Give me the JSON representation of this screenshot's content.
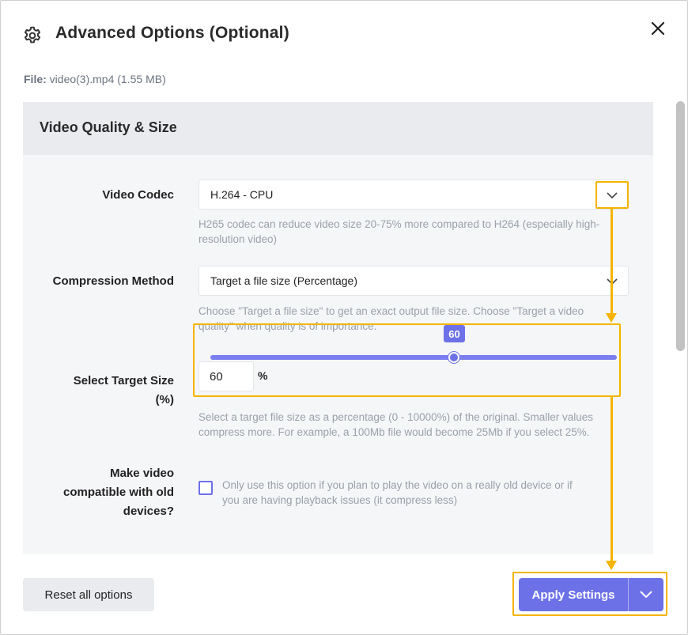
{
  "dialog": {
    "title": "Advanced Options (Optional)",
    "icon": "gear-icon",
    "close_icon": "close-icon"
  },
  "file": {
    "label": "File:",
    "value": "video(3).mp4 (1.55 MB)"
  },
  "section": {
    "title": "Video Quality & Size"
  },
  "video_codec": {
    "label": "Video Codec",
    "value": "H.264 - CPU",
    "help_line1": "H265 codec can reduce video size 20-75% more compared to H264 (especially high-",
    "help_line2": "resolution video)"
  },
  "compression_method": {
    "label": "Compression Method",
    "value": "Target a file size (Percentage)",
    "help_line1": "Choose \"Target a file size\" to get an exact output file size. Choose \"Target a video",
    "help_line2": "quality\" when quality is of importance."
  },
  "target_size": {
    "label_line1": "Select Target Size",
    "label_line2": "(%)",
    "slider_value": "60",
    "input_value": "60",
    "unit": "%",
    "help_line1": "Select a target file size as a percentage (0 - 10000%) of the original. Smaller values",
    "help_line2": "compress more. For example, a 100Mb file would become 25Mb if you select 25%."
  },
  "compatibility": {
    "label_line1": "Make video",
    "label_line2": "compatible with old",
    "label_line3": "devices?",
    "checked": false,
    "help_line1": "Only use this option if you plan to play the video on a really old device or if",
    "help_line2": "you are having playback issues (it compress less)"
  },
  "footer": {
    "reset_label": "Reset all options",
    "apply_label": "Apply Settings"
  },
  "colors": {
    "accent": "#6d71e8",
    "highlight": "#f4b400",
    "panel_bg": "#f5f6f8",
    "panel_header_bg": "#e9ebef"
  }
}
